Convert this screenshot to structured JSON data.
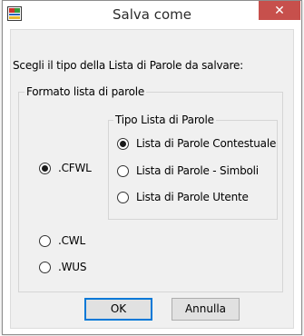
{
  "window": {
    "title": "Salva come",
    "close_glyph": "✕"
  },
  "prompt": "Scegli il tipo della Lista di Parole da salvare:",
  "format_group": {
    "legend": "Formato lista di parole",
    "options": [
      {
        "label": ".CFWL",
        "checked": true
      },
      {
        "label": ".CWL",
        "checked": false
      },
      {
        "label": ".WUS",
        "checked": false
      }
    ]
  },
  "type_group": {
    "legend": "Tipo Lista di Parole",
    "options": [
      {
        "label": "Lista di Parole Contestuale",
        "checked": true
      },
      {
        "label": "Lista di Parole - Simboli",
        "checked": false
      },
      {
        "label": "Lista di Parole Utente",
        "checked": false
      }
    ]
  },
  "buttons": {
    "ok": "OK",
    "cancel": "Annulla"
  },
  "colors": {
    "close_button": "#c7504c",
    "default_button_border": "#0078d7",
    "client_background": "#f0f0f0"
  },
  "icons": {
    "app": "app-icon",
    "close": "close-icon"
  }
}
